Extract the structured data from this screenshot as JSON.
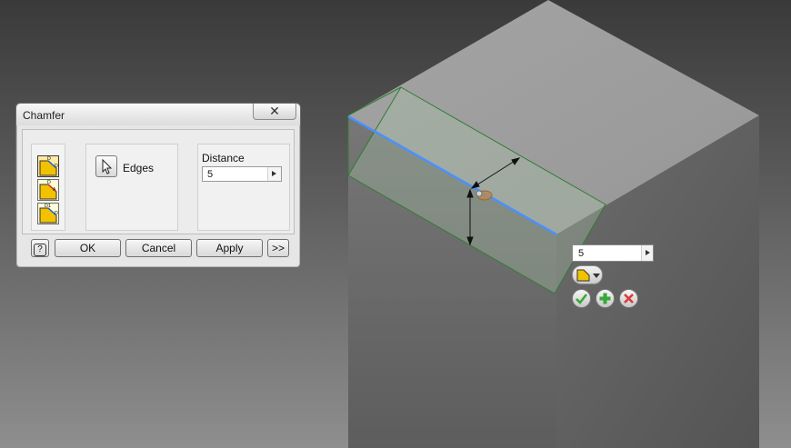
{
  "dialog": {
    "title": "Chamfer",
    "close_label": "✕",
    "edges_label": "Edges",
    "distance_label": "Distance",
    "distance_value": "5",
    "buttons": {
      "help": "?",
      "ok": "OK",
      "cancel": "Cancel",
      "apply": "Apply",
      "more": ">>"
    },
    "methods": [
      "distance-method-icon",
      "distance-angle-method-icon",
      "two-distances-method-icon"
    ]
  },
  "mini_toolbar": {
    "distance_value": "5",
    "icons": [
      "chamfer-method-icon",
      "ok-check-icon",
      "apply-plus-icon",
      "cancel-x-icon"
    ]
  },
  "colors": {
    "selected_edge": "#4a90ff",
    "chamfer_preview": "#2e7d32",
    "ok_green": "#37a837",
    "cancel_red": "#d93a3a"
  }
}
